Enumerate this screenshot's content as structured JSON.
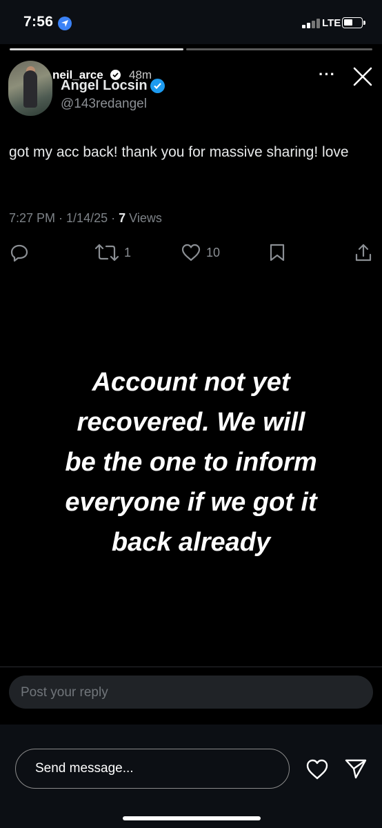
{
  "status_bar": {
    "time": "7:56",
    "network": "LTE",
    "location_icon": "location-arrow-icon",
    "signal_icon": "signal-bars-icon",
    "battery_icon": "battery-icon"
  },
  "story": {
    "username": "neil_arce",
    "age": "48m",
    "more_icon": "more-dots-icon",
    "close_icon": "close-icon",
    "progress_segments": 2,
    "current_segment": 1
  },
  "tweet": {
    "display_name": "Angel Locsin",
    "handle": "@143redangel",
    "text": "got my acc back! thank you for massive sharing! love",
    "time": "7:27 PM",
    "date": "1/14/25",
    "views_count": "7",
    "views_label": "Views",
    "actions": {
      "reply_icon": "reply-icon",
      "retweet_icon": "retweet-icon",
      "retweet_count": "1",
      "like_icon": "heart-icon",
      "like_count": "10",
      "bookmark_icon": "bookmark-icon",
      "share_icon": "share-icon"
    },
    "reply_placeholder": "Post your reply"
  },
  "overlay_text": {
    "lines": [
      "Account not yet",
      "recovered. We will",
      "be the one to inform",
      "everyone if we got it",
      "back already"
    ]
  },
  "message_bar": {
    "placeholder": "Send message...",
    "like_icon": "heart-outline-icon",
    "send_icon": "paper-plane-icon"
  },
  "colors": {
    "background": "#000000",
    "verified_blue": "#1d9bf0",
    "muted_text": "#8b8f94",
    "reply_box": "#202327"
  }
}
